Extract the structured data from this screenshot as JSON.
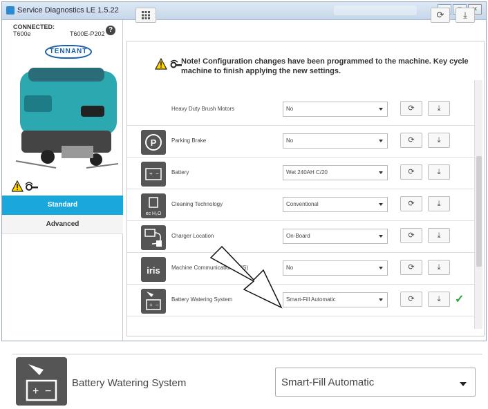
{
  "window": {
    "title": "Service Diagnostics LE 1.5.22"
  },
  "connection": {
    "status": "CONNECTED:",
    "model": "T600e",
    "serial": "T600E-P202"
  },
  "brand": {
    "logo_text": "TENNANT"
  },
  "tabs": {
    "standard": "Standard",
    "advanced": "Advanced"
  },
  "note": {
    "text": "Note! Configuration changes have been programmed to the machine. Key cycle machine to finish applying the new settings."
  },
  "rows": [
    {
      "label": "Heavy Duty Brush Motors",
      "value": "No",
      "icon": "none"
    },
    {
      "label": "Parking Brake",
      "value": "No",
      "icon": "parking-brake-icon"
    },
    {
      "label": "Battery",
      "value": "Wet 240AH C/20",
      "icon": "battery-icon"
    },
    {
      "label": "Cleaning Technology",
      "value": "Conventional",
      "icon": "ec-h2o-icon"
    },
    {
      "label": "Charger Location",
      "value": "On-Board",
      "icon": "charger-icon"
    },
    {
      "label": "Machine Communication (IRIS)",
      "value": "No",
      "icon": "iris-icon"
    },
    {
      "label": "Battery Watering System",
      "value": "Smart-Fill Automatic",
      "icon": "battery-watering-icon"
    }
  ],
  "zoom": {
    "label": "Battery Watering System",
    "value": "Smart-Fill Automatic"
  },
  "colors": {
    "accent": "#1aa7dc",
    "check": "#2fa63b"
  }
}
